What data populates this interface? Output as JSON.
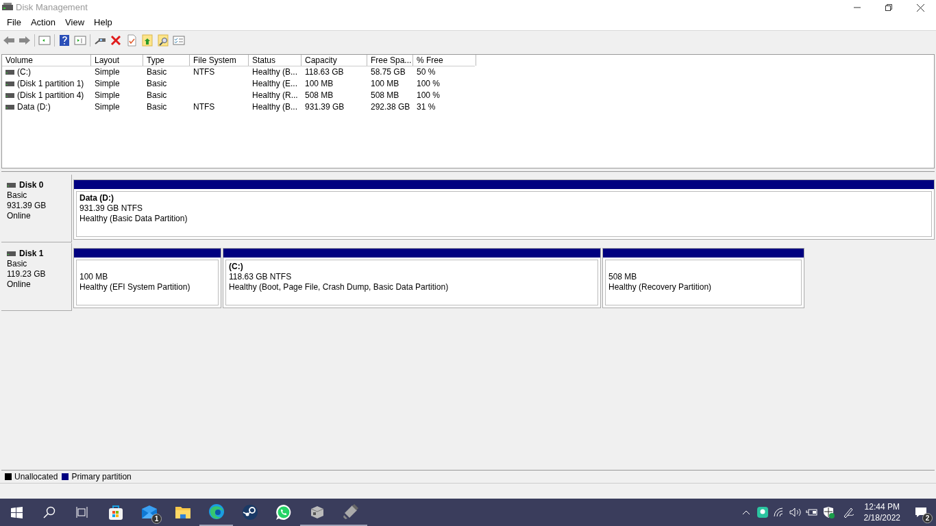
{
  "window": {
    "title": "Disk Management"
  },
  "menu": [
    "File",
    "Action",
    "View",
    "Help"
  ],
  "table": {
    "columns": [
      "Volume",
      "Layout",
      "Type",
      "File System",
      "Status",
      "Capacity",
      "Free Spa...",
      "% Free"
    ],
    "rows": [
      [
        "(C:)",
        "Simple",
        "Basic",
        "NTFS",
        "Healthy (B...",
        "118.63 GB",
        "58.75 GB",
        "50 %"
      ],
      [
        "(Disk 1 partition 1)",
        "Simple",
        "Basic",
        "",
        "Healthy (E...",
        "100 MB",
        "100 MB",
        "100 %"
      ],
      [
        "(Disk 1 partition 4)",
        "Simple",
        "Basic",
        "",
        "Healthy (R...",
        "508 MB",
        "508 MB",
        "100 %"
      ],
      [
        "Data (D:)",
        "Simple",
        "Basic",
        "NTFS",
        "Healthy (B...",
        "931.39 GB",
        "292.38 GB",
        "31 %"
      ]
    ]
  },
  "disks": [
    {
      "name": "Disk 0",
      "type": "Basic",
      "size": "931.39 GB",
      "state": "Online",
      "partitions": [
        {
          "label": "Data  (D:)",
          "size": "931.39 GB NTFS",
          "status": "Healthy (Basic Data Partition)"
        }
      ]
    },
    {
      "name": "Disk 1",
      "type": "Basic",
      "size": "119.23 GB",
      "state": "Online",
      "partitions": [
        {
          "size": "100 MB",
          "status": "Healthy (EFI System Partition)"
        },
        {
          "label": "(C:)",
          "size": "118.63 GB NTFS",
          "status": "Healthy (Boot, Page File, Crash Dump, Basic Data Partition)"
        },
        {
          "size": "508 MB",
          "status": "Healthy (Recovery Partition)"
        }
      ]
    }
  ],
  "legend": [
    {
      "label": "Unallocated",
      "color": "#000000"
    },
    {
      "label": "Primary partition",
      "color": "#000080"
    }
  ],
  "taskbar": {
    "apps": [
      {
        "kind": "store",
        "running": false
      },
      {
        "kind": "mail",
        "badge": "1",
        "running": false
      },
      {
        "kind": "folder",
        "running": false
      },
      {
        "kind": "edge",
        "running": true
      },
      {
        "kind": "steam",
        "running": false
      },
      {
        "kind": "whatsapp",
        "running": false
      },
      {
        "kind": "box",
        "running": true
      },
      {
        "kind": "usb",
        "running": true
      }
    ],
    "time": "12:44 PM",
    "date": "2/18/2022",
    "notifications": "2"
  }
}
